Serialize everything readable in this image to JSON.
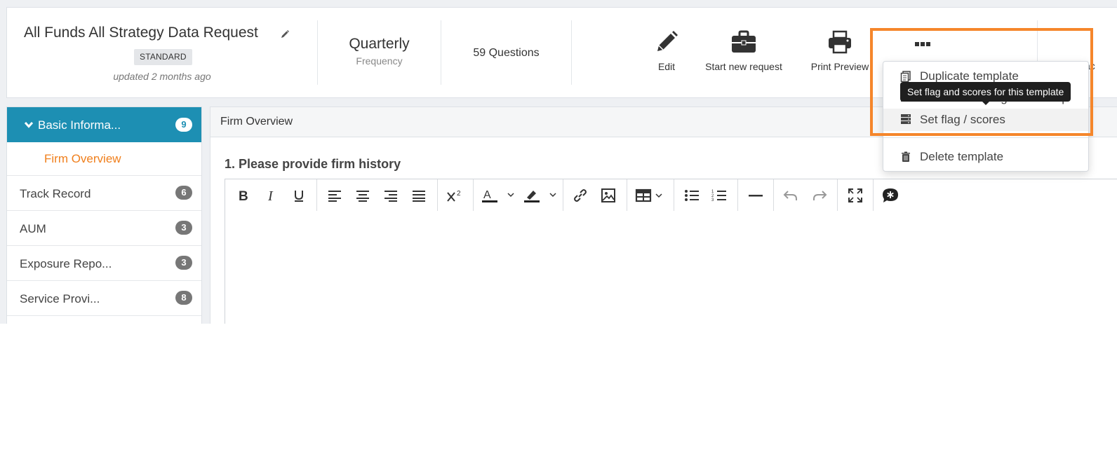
{
  "header": {
    "title": "All Funds All Strategy Data Request",
    "badge": "STANDARD",
    "updated": "updated 2 months ago",
    "frequency_value": "Quarterly",
    "frequency_label": "Frequency",
    "question_count": "59 Questions",
    "actions": {
      "edit": "Edit",
      "start_new_request": "Start new request",
      "print_preview": "Print Preview",
      "back_partial": "ac"
    }
  },
  "sidebar": {
    "active_section": {
      "label": "Basic Informa...",
      "count": "9"
    },
    "active_sub": "Firm Overview",
    "items": [
      {
        "label": "Track Record",
        "count": "6"
      },
      {
        "label": "AUM",
        "count": "3"
      },
      {
        "label": "Exposure Repo...",
        "count": "3"
      },
      {
        "label": "Service Provi...",
        "count": "8"
      }
    ]
  },
  "main": {
    "section_title": "Firm Overview",
    "question": "1. Please provide firm history"
  },
  "dropdown": {
    "items": [
      {
        "label": "Duplicate template",
        "icon": "copy-icon"
      },
      {
        "label": "Generate Rating Score Map",
        "icon": "list-icon"
      },
      {
        "label": "Set flag / scores",
        "icon": "server-icon"
      },
      {
        "label": "Delete template",
        "icon": "trash-icon"
      }
    ]
  },
  "tooltip": "Set flag and scores for this template",
  "colors": {
    "accent_blue": "#1d8fb3",
    "accent_orange": "#f07f1c",
    "highlight_orange": "#f5862b"
  }
}
